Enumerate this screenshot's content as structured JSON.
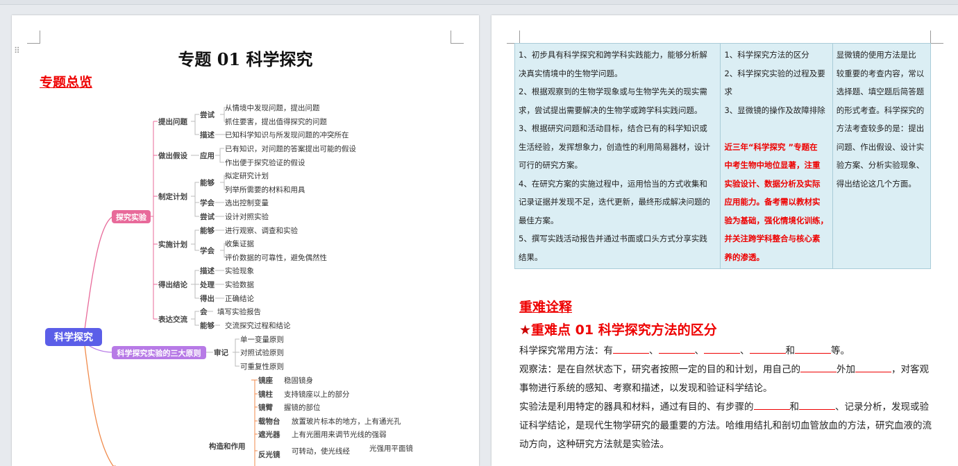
{
  "doc": {
    "title": "专题 01  科学探究",
    "section_overview": "专题总览",
    "section_explain": "重难诠释"
  },
  "mindmap": {
    "root": "科学探究",
    "branches": {
      "inquiry": "探究实验",
      "principles": "科学探究实验的三大原则"
    },
    "steps": {
      "s1": "提出问题",
      "s2": "做出假设",
      "s3": "制定计划",
      "s4": "实施计划",
      "s5": "得出结论",
      "s6": "表达交流",
      "s7": "审记",
      "s8": "构造和作用"
    },
    "verbs": {
      "v1": "尝试",
      "v2": "描述",
      "v3": "应用",
      "v4": "能够",
      "v5": "学会",
      "v6": "尝试",
      "v7": "能够",
      "v8": "学会",
      "v9": "描述",
      "v10": "处理",
      "v11": "得出",
      "v12": "会",
      "v13": "能够"
    },
    "leaves": {
      "l1": "从情境中发现问题，提出问题",
      "l2": "抓住要害，提出值得探究的问题",
      "l3": "已知科学知识与所发现问题的冲突所在",
      "l4": "已有知识，对问题的答案提出可能的假设",
      "l5": "作出便于探究验证的假设",
      "l6": "拟定研究计划",
      "l7": "列举所需要的材料和用具",
      "l8": "选出控制变量",
      "l9": "设计对照实验",
      "l10": "进行观察、调查和实验",
      "l11": "收集证据",
      "l12": "评价数据的可靠性，避免偶然性",
      "l13": "实验现象",
      "l14": "实验数据",
      "l15": "正确结论",
      "l16": "填写实验报告",
      "l17": "交流探究过程和结论",
      "l18": "单一变量原则",
      "l19": "对照试验原则",
      "l20": "可重复性原则"
    },
    "microscope": {
      "p1": "镜座",
      "d1": "稳固镜身",
      "p2": "镜柱",
      "d2": "支持镜座以上的部分",
      "p3": "镜臂",
      "d3": "握镜的部位",
      "p4": "载物台",
      "d4": "放置玻片标本的地方，上有通光孔",
      "p5": "遮光器",
      "d5": "上有光圈用来调节光线的强弱",
      "p6": "反光镜",
      "d6": "可转动，使光线经",
      "d7": "光强用平面镜"
    }
  },
  "table": {
    "col1": [
      "1、初步具有科学探究和跨学科实践能力，能够分析解",
      "决真实情境中的生物学问题。",
      "2、根据观察到的生物学现象或与生物学先关的现实需",
      "求，尝试提出需要解决的生物学或跨学科实践问题。",
      "3、根据研究问题和活动目标，结合已有的科学知识或",
      "生活经验，发挥想象力，创造性的利用简易器材，设计",
      "可行的研究方案。",
      "4、在研究方案的实施过程中，运用恰当的方式收集和",
      "记录证据并发现不足，迭代更新，最终形成解决问题的",
      "最佳方案。",
      "5、撰写实践活动报告并通过书面或口头方式分享实践",
      "结果。"
    ],
    "col2": [
      "1、科学探究方法的区分",
      "2、科学探究实验的过程及要",
      "求",
      "3、显微镜的操作及故障排除"
    ],
    "col2_red": [
      "近三年“科学探究 ”专题在",
      "中考生物中地位显著，注重",
      "实验设计、数据分析及实际",
      "应用能力。备考需以教材实",
      "验为基础，强化情境化训练，",
      "并关注跨学科整合与核心素",
      "养的渗透。"
    ],
    "col3": [
      "显微镜的使用方法是比",
      "较重要的考查内容，常以",
      "选择题、填空题后简答题",
      "的形式考查。科学探究的",
      "方法考查较多的是：提出",
      "问题、作出假设、设计实",
      "验方案、分析实验现象、",
      "得出结论这几个方面。"
    ]
  },
  "focus": {
    "star": "★",
    "title": "重难点 01   科学探究方法的区分",
    "p1_a": "科学探究常用方法：有",
    "sep": "、",
    "and": "和",
    "p1_end": "等。",
    "p2_a": "观察法：是在自然状态下，研究者按照一定的目的和计划，用自己的",
    "p2_b": "外加",
    "p2_c": "，对客观",
    "p2_d": "事物进行系统的感知、考察和描述，以发现和验证科学结论。",
    "p3_a": "实验法是利用特定的器具和材料，通过有目的、有步骤的",
    "p3_b": "、记录分析，发现或验",
    "p3_c": "证科学结论，是现代生物学研究的最重要的方法。哈维用结扎和剖切血管放血的方法，研究血液的流",
    "p3_d": "动方向，这种研究方法就是实验法。"
  },
  "colors": {
    "accent_red": "#e00000",
    "table_bg": "#dbeef4",
    "root_node": "#5b5ee8",
    "branch_pink": "#e86a9a",
    "branch_purple": "#b77ae6"
  }
}
